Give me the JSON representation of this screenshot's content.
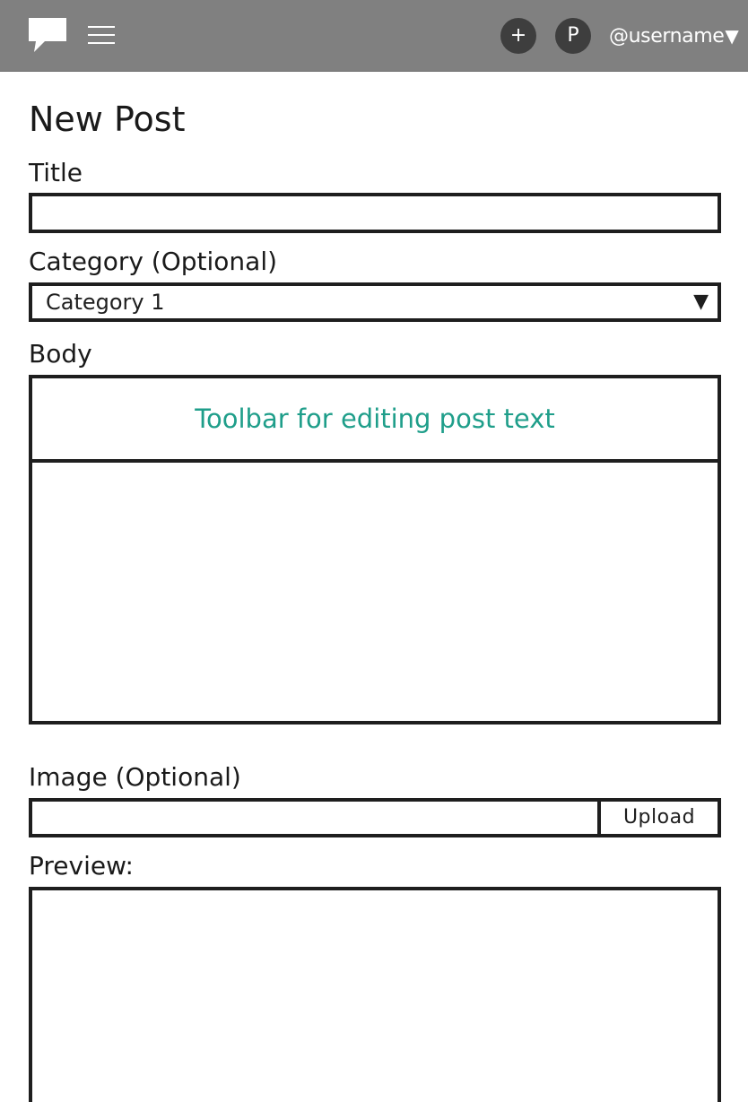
{
  "navbar": {
    "logo_icon": "speech-bubble-icon",
    "menu_icon": "hamburger-menu-icon",
    "add_label": "+",
    "profile_initial": "P",
    "username": "@username",
    "username_caret": "▼"
  },
  "page": {
    "title": "New Post"
  },
  "form": {
    "title_label": "Title",
    "title_value": "",
    "category_label": "Category (Optional)",
    "category_value": "Category 1",
    "category_caret": "▼",
    "body_label": "Body",
    "toolbar_text": "Toolbar for editing post text",
    "body_value": "",
    "image_label": "Image (Optional)",
    "image_value": "",
    "upload_label": "Upload",
    "preview_label": "Preview:"
  },
  "colors": {
    "navbar_bg": "#808080",
    "circle_button_bg": "#3e3e3e",
    "toolbar_text": "#1f9e8a",
    "border": "#1e1e1e"
  }
}
